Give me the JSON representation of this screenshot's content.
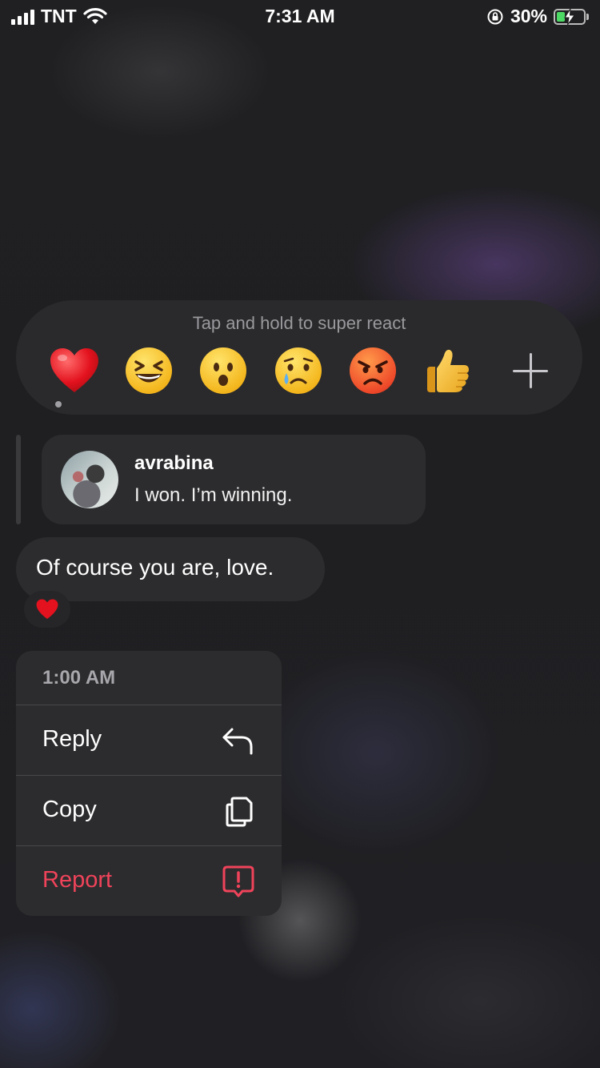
{
  "status_bar": {
    "carrier": "TNT",
    "time": "7:31 AM",
    "battery_percent": "30%",
    "battery_level": 0.3,
    "charging": true
  },
  "reaction_bar": {
    "hint": "Tap and hold to super react",
    "emojis": [
      {
        "name": "heart",
        "selected": true
      },
      {
        "name": "laughing"
      },
      {
        "name": "surprised"
      },
      {
        "name": "crying"
      },
      {
        "name": "angry"
      },
      {
        "name": "thumbs-up"
      }
    ],
    "more_icon": "plus-icon"
  },
  "quoted_message": {
    "username": "avrabina",
    "text": "I won. I’m winning."
  },
  "message": {
    "text": "Of course you are, love.",
    "reaction": "heart"
  },
  "context_menu": {
    "timestamp": "1:00 AM",
    "items": [
      {
        "label": "Reply",
        "icon": "reply-icon"
      },
      {
        "label": "Copy",
        "icon": "copy-icon"
      },
      {
        "label": "Report",
        "icon": "report-icon",
        "color": "#f0435a"
      }
    ]
  },
  "colors": {
    "background": "#1e1e20",
    "bubble": "#2c2c2e",
    "danger": "#f0435a",
    "secondary_text": "#a8a8ac"
  }
}
